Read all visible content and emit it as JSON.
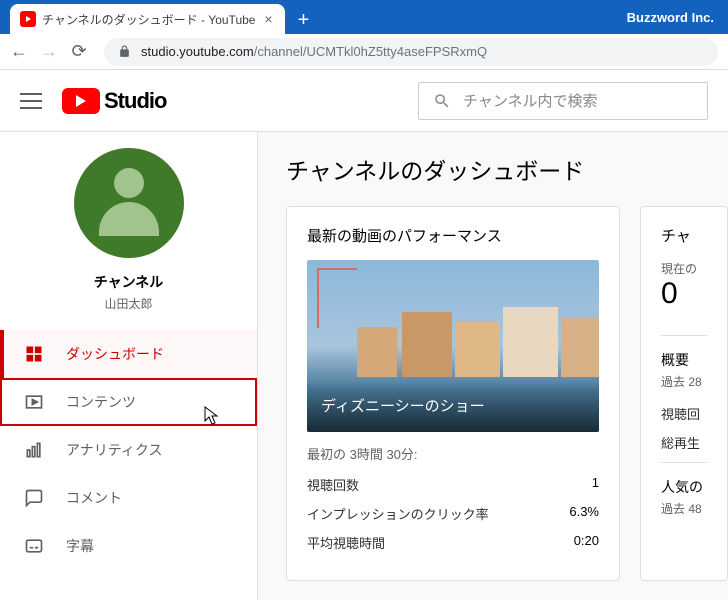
{
  "browser": {
    "tab_title": "チャンネルのダッシュボード - YouTube",
    "brand": "Buzzword Inc.",
    "url_host": "studio.youtube.com",
    "url_path": "/channel/UCMTkl0hZ5tty4aseFPSRxmQ"
  },
  "header": {
    "logo_text": "Studio",
    "search_placeholder": "チャンネル内で検索"
  },
  "sidebar": {
    "channel_heading": "チャンネル",
    "channel_user": "山田太郎",
    "items": [
      {
        "label": "ダッシュボード"
      },
      {
        "label": "コンテンツ"
      },
      {
        "label": "アナリティクス"
      },
      {
        "label": "コメント"
      },
      {
        "label": "字幕"
      }
    ]
  },
  "content": {
    "title": "チャンネルのダッシュボード",
    "perf_card": {
      "heading": "最新の動画のパフォーマンス",
      "video_title": "ディズニーシーのショー",
      "time_label": "最初の 3時間 30分:",
      "rows": [
        {
          "label": "視聴回数",
          "value": "1"
        },
        {
          "label": "インプレッションのクリック率",
          "value": "6.3%"
        },
        {
          "label": "平均視聴時間",
          "value": "0:20"
        }
      ]
    },
    "stats_card": {
      "heading": "チャ",
      "sub1": "現在の",
      "count": "0",
      "summary_label": "概要",
      "summary_sub": "過去 28",
      "row1": "視聴回",
      "row2": "総再生",
      "popular_label": "人気の",
      "popular_sub": "過去 48"
    }
  }
}
